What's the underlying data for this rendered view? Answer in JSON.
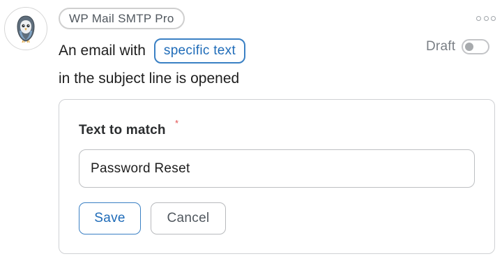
{
  "header": {
    "plugin_name": "WP Mail SMTP Pro",
    "more_icon": "more-horizontal-icon",
    "avatar_icon": "pigeon-logo-icon"
  },
  "status": {
    "label": "Draft",
    "enabled": false
  },
  "trigger": {
    "prefix": "An email with",
    "field_token": "specific text",
    "suffix": "in the subject line is opened"
  },
  "form": {
    "label": "Text to match",
    "required_marker": "*",
    "value": "Password Reset",
    "save_label": "Save",
    "cancel_label": "Cancel"
  },
  "colors": {
    "accent": "#1e6bb8",
    "required": "#e35050",
    "muted": "#50575e"
  }
}
